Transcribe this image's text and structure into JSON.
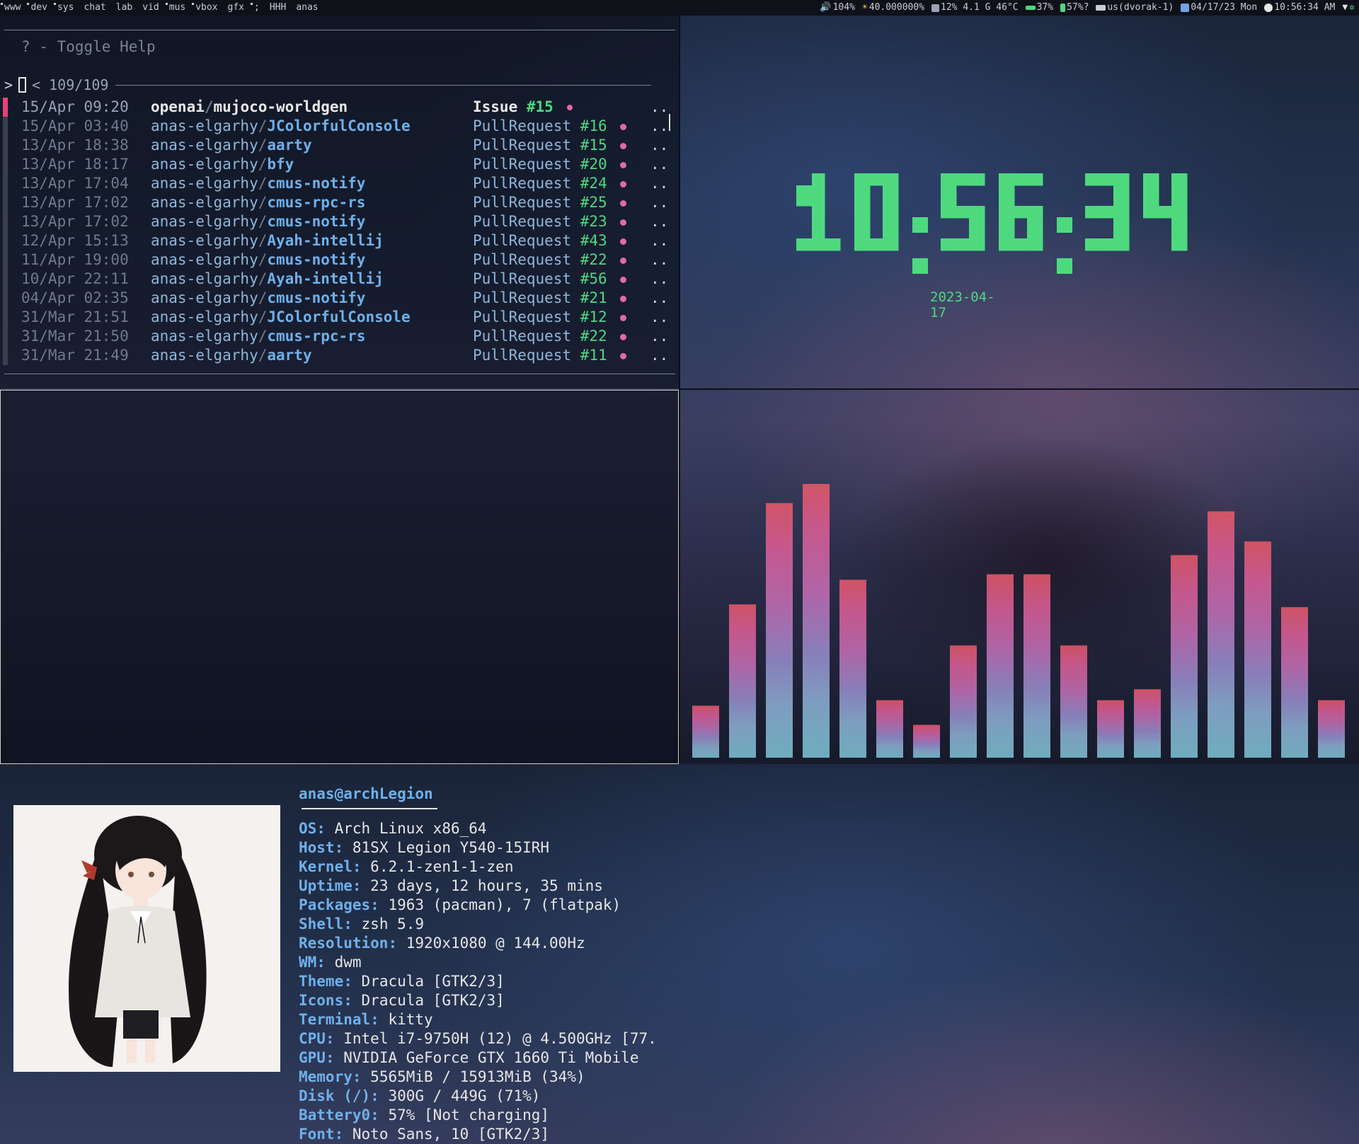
{
  "topbar": {
    "tags": [
      {
        "label": "www",
        "occupied": true
      },
      {
        "label": "dev",
        "occupied": true
      },
      {
        "label": "sys",
        "occupied": true
      },
      {
        "label": "chat",
        "occupied": false
      },
      {
        "label": "lab",
        "occupied": false
      },
      {
        "label": "vid",
        "occupied": false
      },
      {
        "label": "mus",
        "occupied": true
      },
      {
        "label": "vbox",
        "occupied": true
      },
      {
        "label": "gfx",
        "occupied": false
      },
      {
        "label": ";",
        "occupied": true
      },
      {
        "label": "HHH",
        "occupied": false
      },
      {
        "label": "anas",
        "occupied": false
      }
    ],
    "status": {
      "volume": "104%",
      "brightness": "40.000000%",
      "cpu": "12% 4.1 G 46°C",
      "memory": "37%",
      "battery": "57%?",
      "keyboard": "us(dvorak-1)",
      "date": "04/17/23 Mon",
      "time": "10:56:34 AM"
    }
  },
  "gh": {
    "help": "? - Toggle Help",
    "prompt": ">",
    "count": "< 109/109",
    "rows": [
      {
        "date": "15/Apr 09:20",
        "owner": "openai",
        "repo": "mujoco-worldgen",
        "kind": "Issue",
        "num": "#15",
        "selected": true
      },
      {
        "date": "15/Apr 03:40",
        "owner": "anas-elgarhy",
        "repo": "JColorfulConsole",
        "kind": "PullRequest",
        "num": "#16",
        "selected": false
      },
      {
        "date": "13/Apr 18:38",
        "owner": "anas-elgarhy",
        "repo": "aarty",
        "kind": "PullRequest",
        "num": "#15",
        "selected": false
      },
      {
        "date": "13/Apr 18:17",
        "owner": "anas-elgarhy",
        "repo": "bfy",
        "kind": "PullRequest",
        "num": "#20",
        "selected": false
      },
      {
        "date": "13/Apr 17:04",
        "owner": "anas-elgarhy",
        "repo": "cmus-notify",
        "kind": "PullRequest",
        "num": "#24",
        "selected": false
      },
      {
        "date": "13/Apr 17:02",
        "owner": "anas-elgarhy",
        "repo": "cmus-rpc-rs",
        "kind": "PullRequest",
        "num": "#25",
        "selected": false
      },
      {
        "date": "13/Apr 17:02",
        "owner": "anas-elgarhy",
        "repo": "cmus-notify",
        "kind": "PullRequest",
        "num": "#23",
        "selected": false
      },
      {
        "date": "12/Apr 15:13",
        "owner": "anas-elgarhy",
        "repo": "Ayah-intellij",
        "kind": "PullRequest",
        "num": "#43",
        "selected": false
      },
      {
        "date": "11/Apr 19:00",
        "owner": "anas-elgarhy",
        "repo": "cmus-notify",
        "kind": "PullRequest",
        "num": "#22",
        "selected": false
      },
      {
        "date": "10/Apr 22:11",
        "owner": "anas-elgarhy",
        "repo": "Ayah-intellij",
        "kind": "PullRequest",
        "num": "#56",
        "selected": false
      },
      {
        "date": "04/Apr 02:35",
        "owner": "anas-elgarhy",
        "repo": "cmus-notify",
        "kind": "PullRequest",
        "num": "#21",
        "selected": false
      },
      {
        "date": "31/Mar 21:51",
        "owner": "anas-elgarhy",
        "repo": "JColorfulConsole",
        "kind": "PullRequest",
        "num": "#12",
        "selected": false
      },
      {
        "date": "31/Mar 21:50",
        "owner": "anas-elgarhy",
        "repo": "cmus-rpc-rs",
        "kind": "PullRequest",
        "num": "#22",
        "selected": false
      },
      {
        "date": "31/Mar 21:49",
        "owner": "anas-elgarhy",
        "repo": "aarty",
        "kind": "PullRequest",
        "num": "#11",
        "selected": false
      }
    ],
    "more": ".."
  },
  "clock": {
    "time": "10:56:34",
    "date": "2023-04-17",
    "color": "#4ed97f"
  },
  "fetch": {
    "title": "anas@archLegion",
    "lines": [
      {
        "key": "OS",
        "value": "Arch Linux x86_64"
      },
      {
        "key": "Host",
        "value": "81SX Legion Y540-15IRH"
      },
      {
        "key": "Kernel",
        "value": "6.2.1-zen1-1-zen"
      },
      {
        "key": "Uptime",
        "value": "23 days, 12 hours, 35 mins"
      },
      {
        "key": "Packages",
        "value": "1963 (pacman), 7 (flatpak)"
      },
      {
        "key": "Shell",
        "value": "zsh 5.9"
      },
      {
        "key": "Resolution",
        "value": "1920x1080 @ 144.00Hz"
      },
      {
        "key": "WM",
        "value": "dwm"
      },
      {
        "key": "Theme",
        "value": "Dracula [GTK2/3]"
      },
      {
        "key": "Icons",
        "value": "Dracula [GTK2/3]"
      },
      {
        "key": "Terminal",
        "value": "kitty"
      },
      {
        "key": "CPU",
        "value": "Intel i7-9750H (12) @ 4.500GHz [77."
      },
      {
        "key": "GPU",
        "value": "NVIDIA GeForce GTX 1660 Ti Mobile"
      },
      {
        "key": "Memory",
        "value": "5565MiB / 15913MiB (34%)"
      },
      {
        "key": "Disk (/)",
        "value": "300G / 449G (71%)"
      },
      {
        "key": "Battery0",
        "value": "57% [Not charging]"
      },
      {
        "key": "Font",
        "value": "Noto Sans, 10 [GTK2/3]"
      }
    ]
  },
  "visualizer": {
    "levels": [
      0.19,
      0.56,
      0.93,
      1.0,
      0.65,
      0.21,
      0.12,
      0.41,
      0.67,
      0.67,
      0.41,
      0.21,
      0.25,
      0.74,
      0.9,
      0.79,
      0.55,
      0.21
    ]
  }
}
